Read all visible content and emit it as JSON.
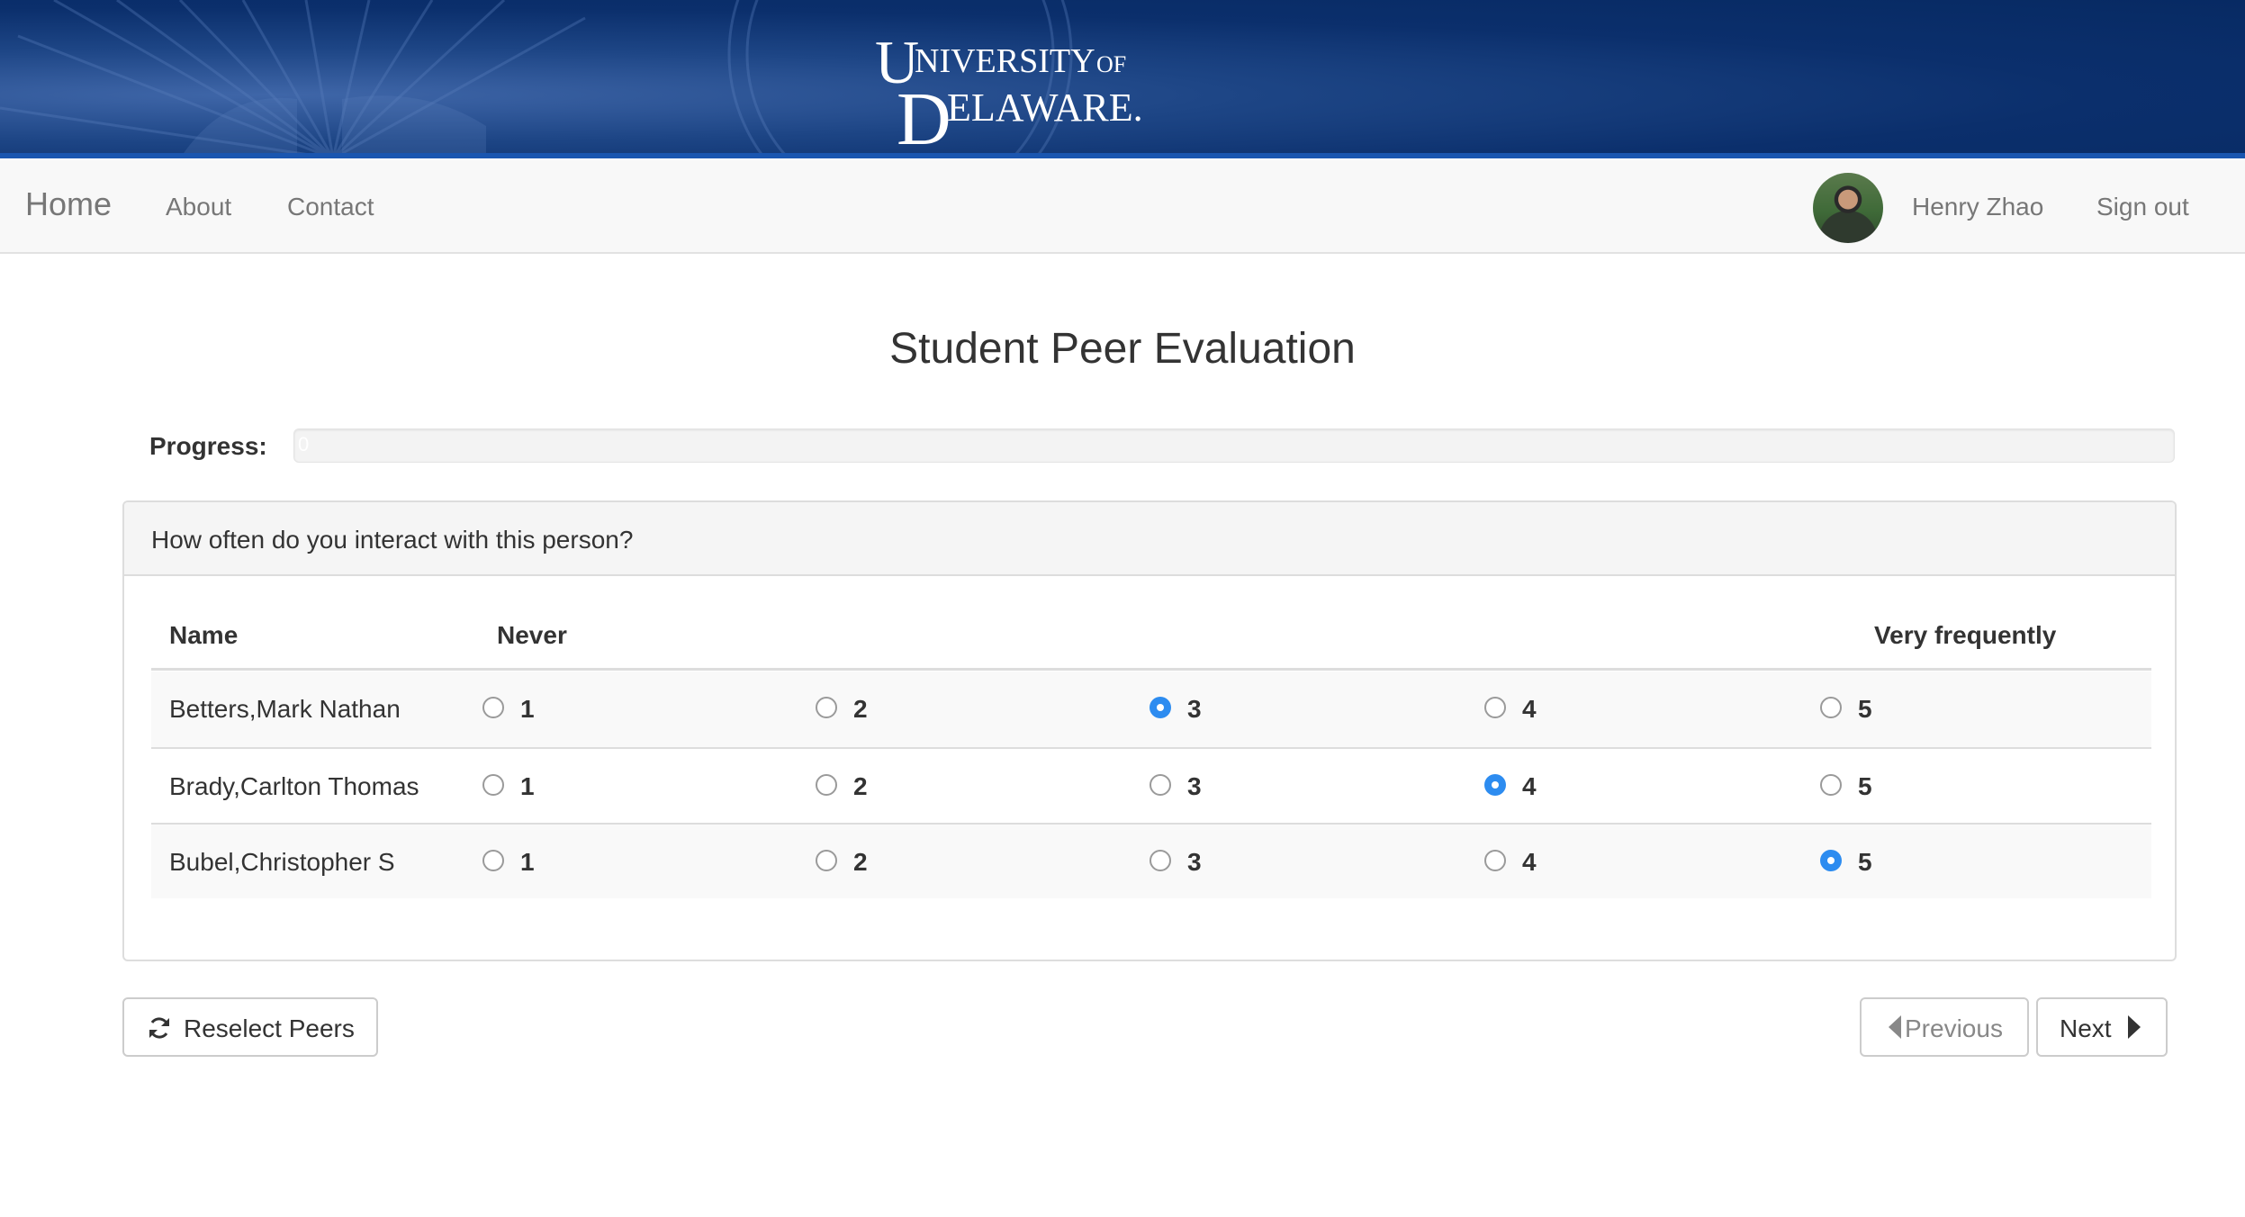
{
  "header": {
    "logo_text": "UNIVERSITY OF DELAWARE"
  },
  "nav": {
    "brand": "Home",
    "links": [
      "About",
      "Contact"
    ],
    "user_name": "Henry Zhao",
    "sign_out": "Sign out"
  },
  "page": {
    "title": "Student Peer Evaluation",
    "progress_label": "Progress:",
    "progress_value": 0,
    "progress_text": "0"
  },
  "question": {
    "text": "How often do you interact with this person?",
    "columns": {
      "name": "Name",
      "low": "Never",
      "high": "Very frequently"
    },
    "options": [
      "1",
      "2",
      "3",
      "4",
      "5"
    ],
    "rows": [
      {
        "name": "Betters,Mark Nathan",
        "selected": "3"
      },
      {
        "name": "Brady,Carlton Thomas",
        "selected": "4"
      },
      {
        "name": "Bubel,Christopher S",
        "selected": "5"
      }
    ]
  },
  "buttons": {
    "reselect": "Reselect Peers",
    "previous": "Previous",
    "next": "Next"
  },
  "icons": {
    "reselect": "refresh-icon",
    "previous": "caret-left-icon",
    "next": "caret-right-icon"
  },
  "colors": {
    "banner": "#0b2f6c",
    "radio_checked": "#2d8cf0"
  }
}
